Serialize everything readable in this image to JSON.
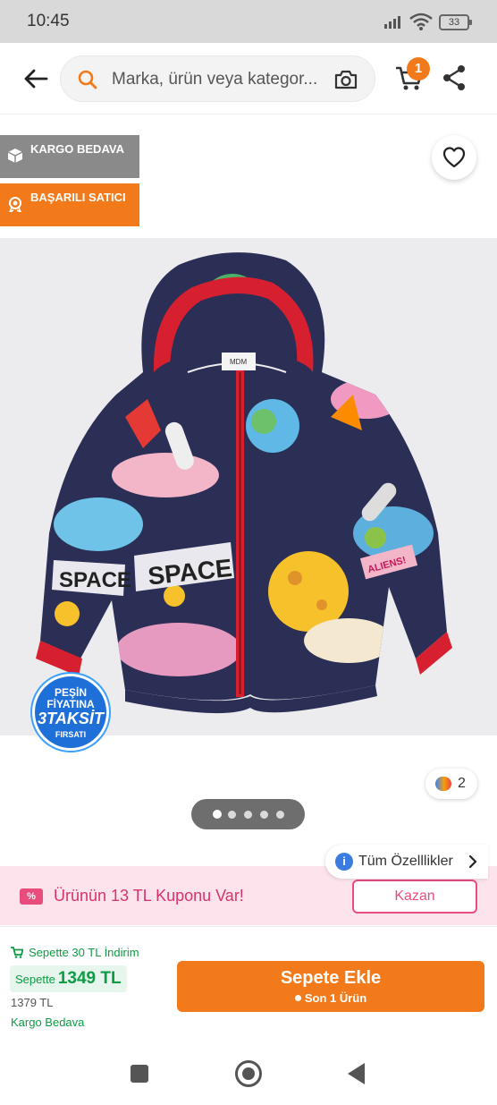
{
  "status_bar": {
    "time": "10:45",
    "battery": "33"
  },
  "search": {
    "placeholder": "Marka, ürün veya kategor..."
  },
  "header": {
    "cart_count": "1"
  },
  "badges": {
    "kargo": "KARGO BEDAVA",
    "satici": "BAŞARILI SATICI"
  },
  "product": {
    "image_texts": {
      "space_1": "SPACE",
      "space_2": "SPACE",
      "aliens": "ALIENS!",
      "label": "MDM"
    },
    "taksit": {
      "line1": "PEŞİN FİYATINA",
      "line2": "3TAKSİT",
      "line3": "FIRSATI"
    },
    "color_count": "2",
    "pager": {
      "count": 5,
      "active": 0
    }
  },
  "features": {
    "label": "Tüm Özelllikler"
  },
  "coupon": {
    "text": "Ürünün 13 TL Kuponu Var!",
    "button": "Kazan",
    "icon_text": "%"
  },
  "purchase": {
    "discount": "Sepette 30 TL İndirim",
    "price_label": "Sepette",
    "price": "1349 TL",
    "old_price": "1379 TL",
    "shipping": "Kargo Bedava",
    "button_label": "Sepete Ekle",
    "stock_note": "Son 1 Ürün"
  },
  "colors": {
    "brand_orange": "#f27a1a",
    "green": "#0e9b45",
    "pink": "#e94d7d"
  }
}
